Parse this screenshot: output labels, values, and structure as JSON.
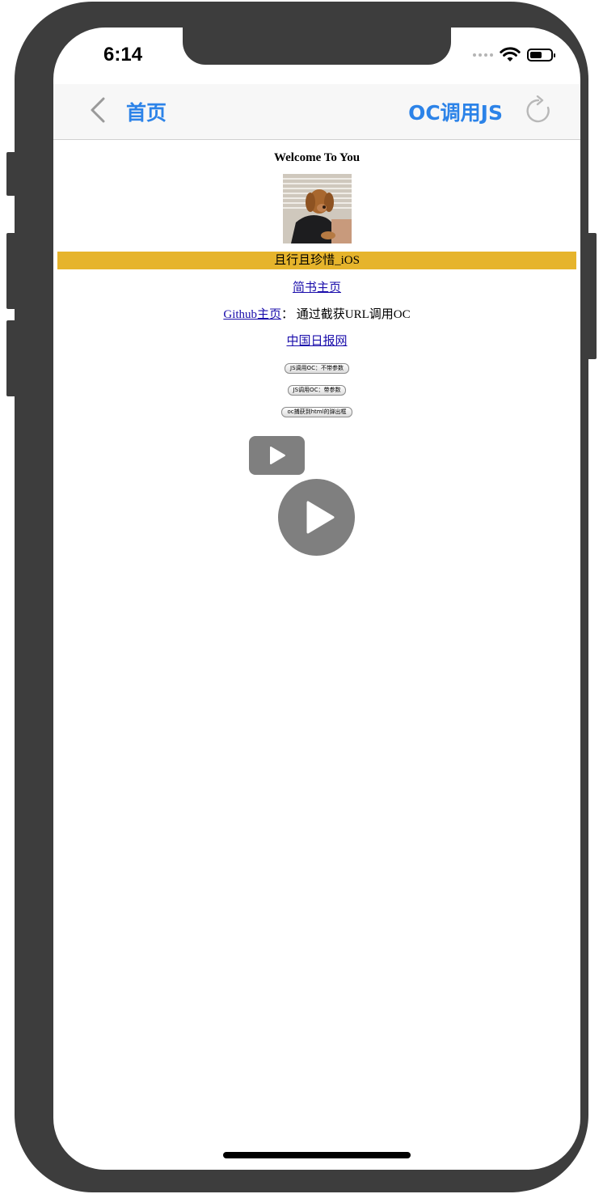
{
  "status_bar": {
    "time": "6:14"
  },
  "navbar": {
    "back_label": "首页",
    "right_label": "OC调用JS",
    "accent_color": "#2c83e8",
    "back_icon": "chevron-left-icon",
    "refresh_icon": "refresh-icon"
  },
  "page": {
    "heading": "Welcome To You",
    "banner_text": "且行且珍惜_iOS",
    "banner_color": "#e6b42c",
    "links": {
      "jianshu": "简书主页",
      "github": "Github主页",
      "github_suffix": "： 通过截获URL调用OC",
      "chinadaily": "中国日报网"
    },
    "buttons": [
      "JS调用OC：不带参数",
      "JS调用OC：带参数",
      "oc捕获到html的弹出框"
    ]
  }
}
